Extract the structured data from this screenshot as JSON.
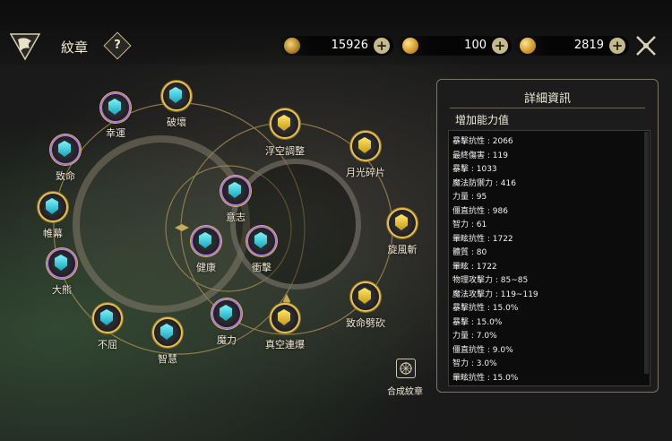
{
  "header": {
    "title": "紋章",
    "help_label": "?",
    "currencies": [
      {
        "icon": "cycle-coin-icon",
        "value": "15926"
      },
      {
        "icon": "gold-bar-icon",
        "value": "100"
      },
      {
        "icon": "gold-coin-icon",
        "value": "2819"
      }
    ],
    "plus_label": "+"
  },
  "emblems": [
    {
      "label": "幸運",
      "style": "purple",
      "color": "cyan"
    },
    {
      "label": "破壞",
      "style": "gold",
      "color": "cyan"
    },
    {
      "label": "致命",
      "style": "purple",
      "color": "cyan"
    },
    {
      "label": "帷幕",
      "style": "gold",
      "color": "cyan"
    },
    {
      "label": "大熊",
      "style": "purple",
      "color": "cyan"
    },
    {
      "label": "不屈",
      "style": "gold",
      "color": "cyan"
    },
    {
      "label": "智慧",
      "style": "gold",
      "color": "cyan"
    },
    {
      "label": "魔力",
      "style": "purple",
      "color": "cyan"
    },
    {
      "label": "真空連爆",
      "style": "gold",
      "color": "yellow"
    },
    {
      "label": "意志",
      "style": "purple",
      "color": "cyan"
    },
    {
      "label": "健康",
      "style": "purple",
      "color": "cyan"
    },
    {
      "label": "衝擊",
      "style": "purple",
      "color": "cyan"
    },
    {
      "label": "浮空調整",
      "style": "gold",
      "color": "yellow"
    },
    {
      "label": "月光碎片",
      "style": "gold",
      "color": "yellow"
    },
    {
      "label": "旋風斬",
      "style": "gold",
      "color": "yellow"
    },
    {
      "label": "致命劈砍",
      "style": "gold",
      "color": "yellow"
    }
  ],
  "details": {
    "title": "詳細資訊",
    "subtitle": "增加能力值",
    "stats": [
      "暴擊抗性 : 2066",
      "最終傷害 : 119",
      "暴擊 : 1033",
      "魔法防禦力 : 416",
      "力量 : 95",
      "僵直抗性 : 986",
      "智力 : 61",
      "暈眩抗性 : 1722",
      "體質 : 80",
      "暈眩 : 1722",
      "物理攻擊力 : 85~85",
      "魔法攻擊力 : 119~119",
      "暴擊抗性 : 15.0%",
      "暴擊 : 15.0%",
      "力量 : 7.0%",
      "僵直抗性 : 9.0%",
      "智力 : 3.0%",
      "暈眩抗性 : 15.0%"
    ]
  },
  "synthesis": {
    "label": "合成紋章",
    "icon": "synthesis-icon"
  }
}
